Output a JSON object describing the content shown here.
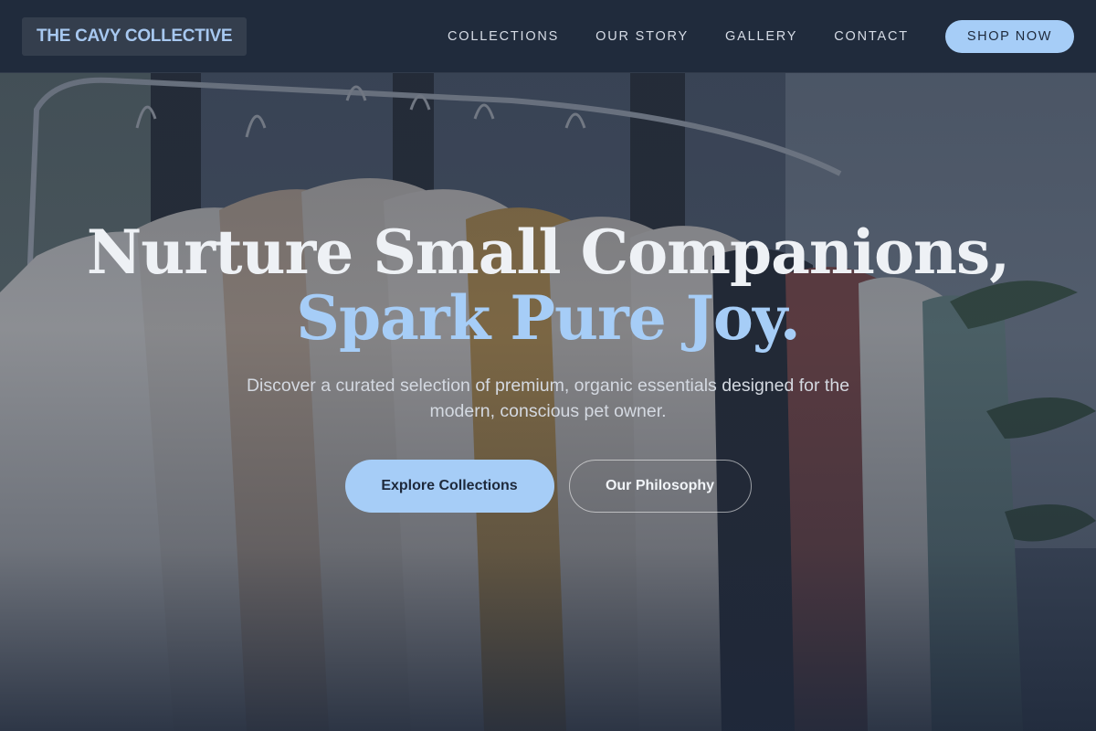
{
  "navbar": {
    "brand": "THE CAVY COLLECTIVE",
    "links": [
      {
        "label": "COLLECTIONS"
      },
      {
        "label": "OUR STORY"
      },
      {
        "label": "GALLERY"
      },
      {
        "label": "CONTACT"
      }
    ],
    "cta_label": "SHOP NOW"
  },
  "hero": {
    "headline_line1": "Nurture Small Companions,",
    "headline_line2": "Spark Pure Joy.",
    "subtitle": "Discover a curated selection of premium, organic essentials designed for the modern, conscious pet owner.",
    "primary_button": "Explore Collections",
    "secondary_button": "Our Philosophy",
    "background_image": "clothing-rack-photo"
  },
  "colors": {
    "accent": "#a6cdf7",
    "navbar_bg": "#1e293b",
    "headline": "#eef1f5"
  }
}
